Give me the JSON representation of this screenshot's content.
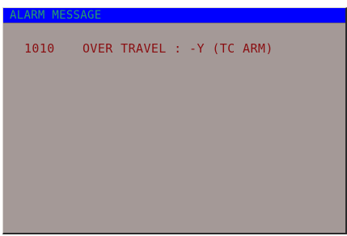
{
  "window": {
    "title": "ALARM MESSAGE"
  },
  "alarm": {
    "code": "1010",
    "message": "OVER TRAVEL : -Y (TC ARM)"
  },
  "colors": {
    "titlebar_bg": "#0000ff",
    "title_text": "#26a06a",
    "panel_bg": "#a49997",
    "alarm_text": "#8a0f12"
  }
}
